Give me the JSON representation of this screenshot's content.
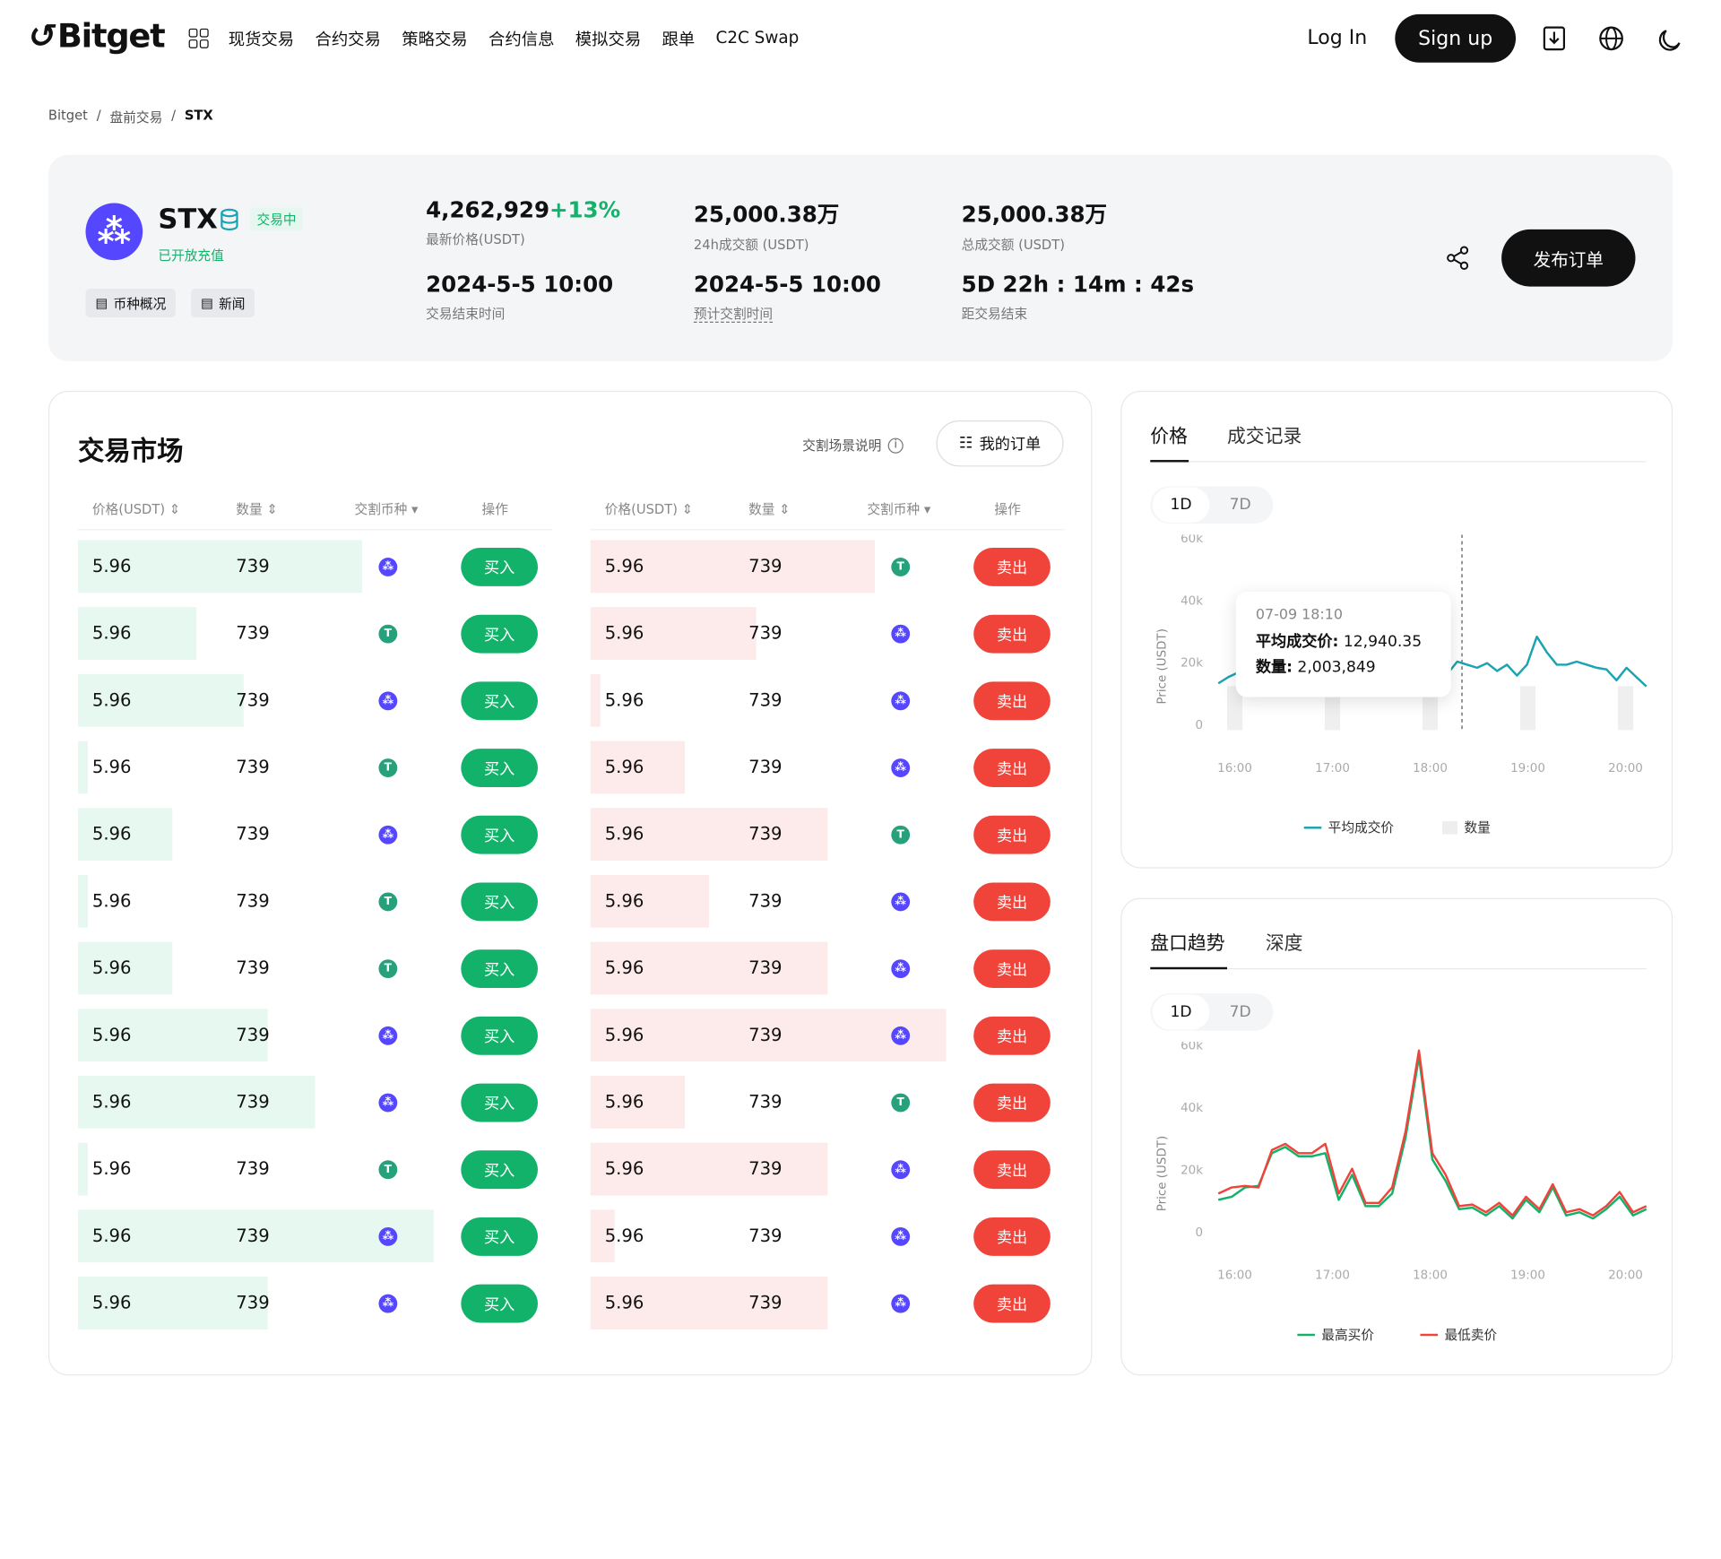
{
  "nav": {
    "logo": "Bitget",
    "menu": [
      "现货交易",
      "合约交易",
      "策略交易",
      "合约信息",
      "模拟交易",
      "跟单",
      "C2C Swap"
    ],
    "login": "Log In",
    "signup": "Sign up"
  },
  "breadcrumb": [
    "Bitget",
    "盘前交易",
    "STX"
  ],
  "token": {
    "symbol": "STX",
    "status": "交易中",
    "deposit": "已开放充值",
    "chips": [
      "币种概况",
      "新闻"
    ],
    "stats": [
      {
        "value": "4,262,929",
        "change": "+13%",
        "label": "最新价格(USDT)"
      },
      {
        "value": "25,000.38万",
        "label": "24h成交额 (USDT)"
      },
      {
        "value": "25,000.38万",
        "label": "总成交额 (USDT)"
      },
      {
        "value": "2024-5-5 10:00",
        "label": "交易结束时间"
      },
      {
        "value": "2024-5-5 10:00",
        "label": "预计交割时间"
      },
      {
        "value": "5D 22h : 14m : 42s",
        "label": "距交易结束"
      }
    ],
    "publish": "发布订单"
  },
  "market": {
    "title": "交易市场",
    "info": "交割场景说明",
    "my_orders": "我的订单",
    "headers": [
      "价格(USDT)",
      "数量",
      "交割币种",
      "操作"
    ],
    "buy_label": "买入",
    "sell_label": "卖出",
    "buy_rows": [
      {
        "price": "5.96",
        "qty": "739",
        "token": "stx",
        "depth": 0.6
      },
      {
        "price": "5.96",
        "qty": "739",
        "token": "usdt",
        "depth": 0.25
      },
      {
        "price": "5.96",
        "qty": "739",
        "token": "stx",
        "depth": 0.35
      },
      {
        "price": "5.96",
        "qty": "739",
        "token": "usdt",
        "depth": 0.02
      },
      {
        "price": "5.96",
        "qty": "739",
        "token": "stx",
        "depth": 0.2
      },
      {
        "price": "5.96",
        "qty": "739",
        "token": "usdt",
        "depth": 0.02
      },
      {
        "price": "5.96",
        "qty": "739",
        "token": "usdt",
        "depth": 0.2
      },
      {
        "price": "5.96",
        "qty": "739",
        "token": "stx",
        "depth": 0.4
      },
      {
        "price": "5.96",
        "qty": "739",
        "token": "stx",
        "depth": 0.5
      },
      {
        "price": "5.96",
        "qty": "739",
        "token": "usdt",
        "depth": 0.02
      },
      {
        "price": "5.96",
        "qty": "739",
        "token": "stx",
        "depth": 0.75
      },
      {
        "price": "5.96",
        "qty": "739",
        "token": "stx",
        "depth": 0.4
      }
    ],
    "sell_rows": [
      {
        "price": "5.96",
        "qty": "739",
        "token": "usdt",
        "depth": 0.6
      },
      {
        "price": "5.96",
        "qty": "739",
        "token": "stx",
        "depth": 0.35
      },
      {
        "price": "5.96",
        "qty": "739",
        "token": "stx",
        "depth": 0.02
      },
      {
        "price": "5.96",
        "qty": "739",
        "token": "stx",
        "depth": 0.2
      },
      {
        "price": "5.96",
        "qty": "739",
        "token": "usdt",
        "depth": 0.5
      },
      {
        "price": "5.96",
        "qty": "739",
        "token": "stx",
        "depth": 0.25
      },
      {
        "price": "5.96",
        "qty": "739",
        "token": "stx",
        "depth": 0.5
      },
      {
        "price": "5.96",
        "qty": "739",
        "token": "stx",
        "depth": 0.75
      },
      {
        "price": "5.96",
        "qty": "739",
        "token": "usdt",
        "depth": 0.2
      },
      {
        "price": "5.96",
        "qty": "739",
        "token": "stx",
        "depth": 0.5
      },
      {
        "price": "5.96",
        "qty": "739",
        "token": "stx",
        "depth": 0.05
      },
      {
        "price": "5.96",
        "qty": "739",
        "token": "stx",
        "depth": 0.5
      }
    ]
  },
  "price_panel": {
    "tabs": [
      "价格",
      "成交记录"
    ],
    "ranges": [
      "1D",
      "7D"
    ],
    "tooltip": {
      "time": "07-09 18:10",
      "price_label": "平均成交价:",
      "price": "12,940.35",
      "qty_label": "数量:",
      "qty": "2,003,849"
    }
  },
  "depth_panel": {
    "tabs": [
      "盘口趋势",
      "深度"
    ],
    "ranges": [
      "1D",
      "7D"
    ]
  },
  "colors": {
    "buy": "#13b26b",
    "sell": "#f0433a",
    "line": "#1aa3b0",
    "brand": "#5546ff"
  },
  "chart_data": [
    {
      "type": "line",
      "ylabel": "Price (USDT)",
      "yticks": [
        "0",
        "20k",
        "40k",
        "60k"
      ],
      "ylim": [
        0,
        60000
      ],
      "xticks": [
        "16:00",
        "17:00",
        "18:00",
        "19:00",
        "20:00"
      ],
      "legend": [
        "平均成交价",
        "数量"
      ],
      "x": [
        "15:50",
        "15:56",
        "16:02",
        "16:08",
        "16:14",
        "16:20",
        "16:26",
        "16:32",
        "16:38",
        "16:44",
        "16:50",
        "16:56",
        "17:02",
        "17:08",
        "17:14",
        "17:20",
        "17:26",
        "17:32",
        "17:38",
        "17:44",
        "17:50",
        "17:56",
        "18:02",
        "18:08",
        "18:14",
        "18:20",
        "18:26",
        "18:32",
        "18:38",
        "18:44",
        "18:50",
        "18:56",
        "19:02",
        "19:08",
        "19:14",
        "19:20",
        "19:26",
        "19:32",
        "19:38",
        "19:44",
        "19:50",
        "19:56",
        "20:02"
      ],
      "series": [
        {
          "name": "平均成交价",
          "values": [
            15000,
            17000,
            18500,
            18000,
            19000,
            18000,
            19500,
            20000,
            19500,
            20000,
            21000,
            20000,
            20500,
            19000,
            22000,
            16000,
            21000,
            17000,
            22000,
            20000,
            21000,
            19500,
            21000,
            18000,
            22000,
            21000,
            20000,
            21500,
            19000,
            21000,
            17500,
            21000,
            30000,
            25000,
            21000,
            21000,
            22000,
            21000,
            20000,
            19500,
            16000,
            20000,
            17000,
            14000
          ]
        }
      ]
    },
    {
      "type": "line",
      "ylabel": "Price (USDT)",
      "yticks": [
        "0",
        "20k",
        "40k",
        "60k"
      ],
      "ylim": [
        0,
        60000
      ],
      "xticks": [
        "16:00",
        "17:00",
        "18:00",
        "19:00",
        "20:00"
      ],
      "legend": [
        "最高买价",
        "最低卖价"
      ],
      "x": [
        "15:50",
        "15:56",
        "16:02",
        "16:08",
        "16:14",
        "16:20",
        "16:26",
        "16:32",
        "16:38",
        "16:44",
        "16:50",
        "16:56",
        "17:02",
        "17:08",
        "17:14",
        "17:20",
        "17:26",
        "17:32",
        "17:38",
        "17:44",
        "17:50",
        "17:56",
        "18:02",
        "18:08",
        "18:14",
        "18:20",
        "18:26",
        "18:32",
        "18:38",
        "18:44",
        "18:50",
        "18:56",
        "19:02",
        "19:08",
        "19:14",
        "19:20",
        "19:26",
        "19:32",
        "19:38",
        "19:44",
        "19:50",
        "19:56",
        "20:02"
      ],
      "series": [
        {
          "name": "最高买价",
          "values": [
            12000,
            13000,
            16000,
            16500,
            27000,
            29000,
            26000,
            26000,
            27000,
            12000,
            20000,
            10000,
            10000,
            14000,
            32000,
            58000,
            25000,
            18000,
            9000,
            9500,
            7000,
            10000,
            6000,
            12000,
            8000,
            16000,
            7000,
            8000,
            6000,
            9000,
            13000,
            7000,
            9000
          ]
        },
        {
          "name": "最低卖价",
          "values": [
            14000,
            16000,
            16500,
            16000,
            28000,
            30000,
            27000,
            27000,
            30000,
            14000,
            22000,
            11000,
            11000,
            16000,
            34000,
            60000,
            27000,
            20000,
            10000,
            10500,
            8000,
            11000,
            7000,
            13000,
            9000,
            17000,
            8000,
            9000,
            7000,
            10000,
            14500,
            8000,
            10000
          ]
        }
      ]
    }
  ]
}
